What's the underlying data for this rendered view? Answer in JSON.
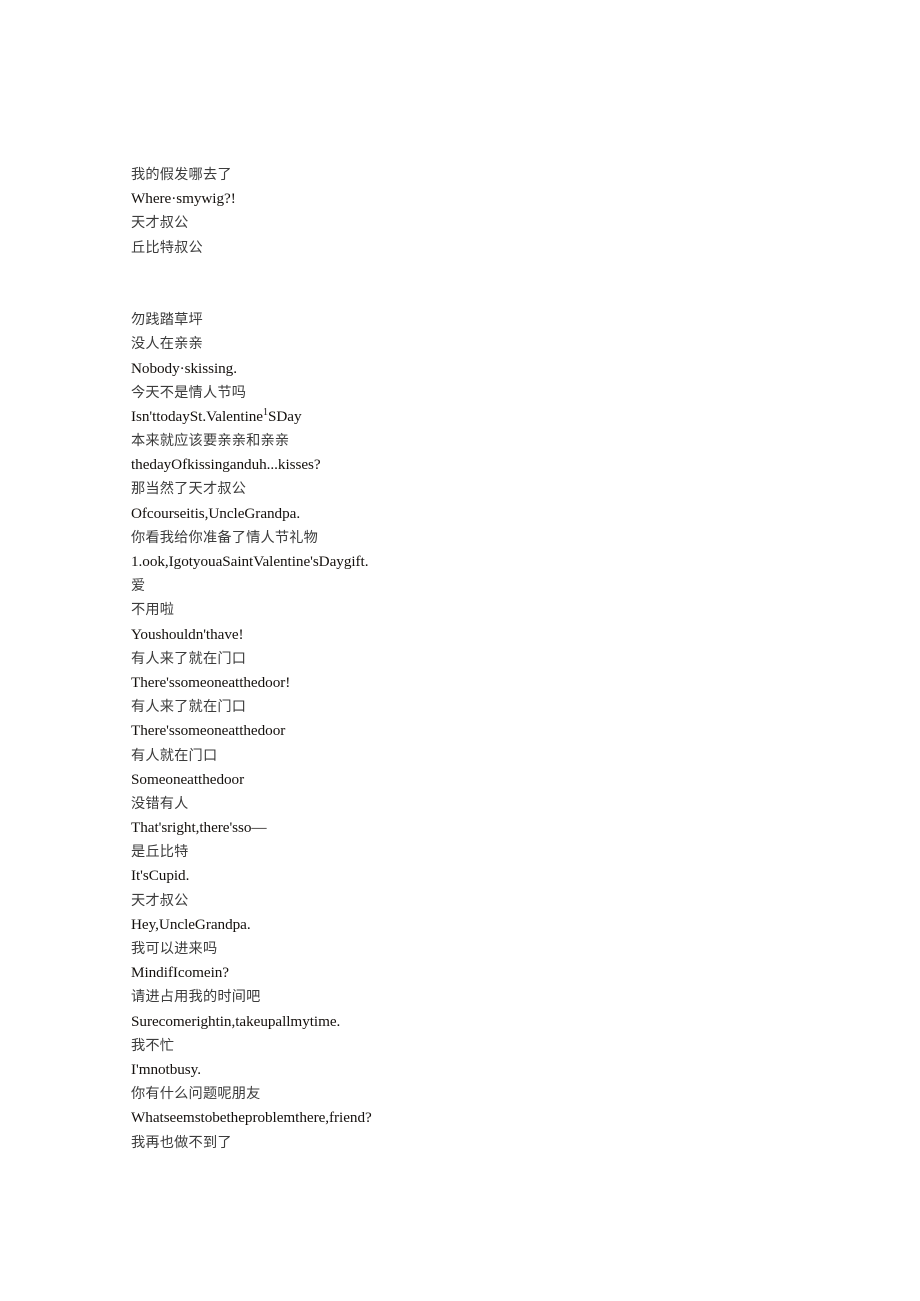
{
  "document": {
    "type": "bilingual-subtitle-transcript",
    "background_color": "#ffffff",
    "chinese_text_color": "#3c3c3c",
    "english_text_color": "#14100d",
    "blocks": [
      {
        "id": "block-1",
        "lines": [
          {
            "lang": "zh",
            "text": "我的假发哪去了"
          },
          {
            "lang": "en",
            "text": "Where·smywig?!"
          },
          {
            "lang": "zh",
            "text": "天才叔公"
          },
          {
            "lang": "zh",
            "text": "丘比特叔公"
          }
        ]
      },
      {
        "id": "block-2",
        "lines": [
          {
            "lang": "zh",
            "text": "勿践踏草坪"
          },
          {
            "lang": "zh",
            "text": "没人在亲亲"
          },
          {
            "lang": "en",
            "text": "Nobody·skissing."
          },
          {
            "lang": "zh",
            "text": "今天不是情人节吗"
          },
          {
            "lang": "en",
            "text": "Isn'ttodaySt.Valentine",
            "sup": "1",
            "text_after": "SDay"
          },
          {
            "lang": "zh",
            "text": "本来就应该要亲亲和亲亲"
          },
          {
            "lang": "en",
            "text": "thedayOfkissinganduh...kisses?"
          },
          {
            "lang": "zh",
            "text": "那当然了天才叔公"
          },
          {
            "lang": "en",
            "text": "Ofcourseitis,UncleGrandpa."
          },
          {
            "lang": "zh",
            "text": "你看我给你准备了情人节礼物"
          },
          {
            "lang": "en",
            "text": "1.ook,IgotyouaSaintValentine'sDaygift."
          },
          {
            "lang": "zh",
            "text": "爱"
          },
          {
            "lang": "zh",
            "text": "不用啦"
          },
          {
            "lang": "en",
            "text": "Youshouldn'thave!"
          },
          {
            "lang": "zh",
            "text": "有人来了就在门口"
          },
          {
            "lang": "en",
            "text": "There'ssomeoneatthedoor!"
          },
          {
            "lang": "zh",
            "text": "有人来了就在门口"
          },
          {
            "lang": "en",
            "text": "There'ssomeoneatthedoor"
          },
          {
            "lang": "zh",
            "text": "有人就在门口"
          },
          {
            "lang": "en",
            "text": "Someoneatthedoor"
          },
          {
            "lang": "zh",
            "text": "没错有人"
          },
          {
            "lang": "en",
            "text": "That'sright,there'sso—"
          },
          {
            "lang": "zh",
            "text": "是丘比特"
          },
          {
            "lang": "en",
            "text": "It'sCupid."
          },
          {
            "lang": "zh",
            "text": "天才叔公"
          },
          {
            "lang": "en",
            "text": "Hey,UncleGrandpa."
          },
          {
            "lang": "zh",
            "text": "我可以进来吗"
          },
          {
            "lang": "en",
            "text": "MindifIcomein?"
          },
          {
            "lang": "zh",
            "text": "请进占用我的时间吧"
          },
          {
            "lang": "en",
            "text": "Surecomerightin,takeupallmytime."
          },
          {
            "lang": "zh",
            "text": "我不忙"
          },
          {
            "lang": "en",
            "text": "I'mnotbusy."
          },
          {
            "lang": "zh",
            "text": "你有什么问题呢朋友"
          },
          {
            "lang": "en",
            "text": "Whatseemstobetheproblemthere,friend?"
          },
          {
            "lang": "zh",
            "text": "我再也做不到了"
          }
        ]
      }
    ],
    "block_gap_lines": 2
  }
}
